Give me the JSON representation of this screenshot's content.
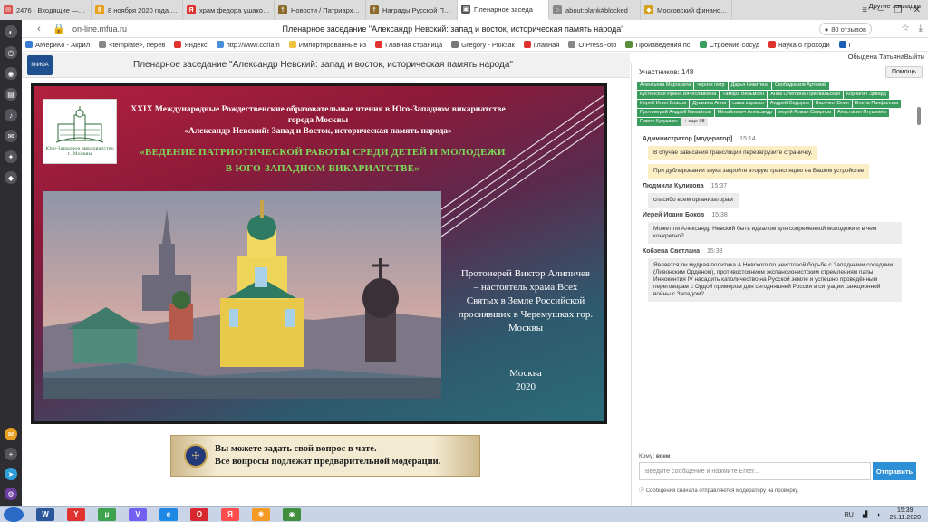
{
  "browser": {
    "tabs": [
      {
        "title": "2476 · Входящие — Яндекс",
        "color": "#d9534f",
        "glyph": "✉"
      },
      {
        "title": "8 ноября 2020 года. + Пр",
        "color": "#e8a020",
        "glyph": "8"
      },
      {
        "title": "храм федора ушакова в",
        "color": "#e0322e",
        "glyph": "Я"
      },
      {
        "title": "Новости / Патриархия.ru",
        "color": "#8a6a2a",
        "glyph": "†"
      },
      {
        "title": "Награды Русской Правос",
        "color": "#8a6a2a",
        "glyph": "†"
      },
      {
        "title": "Пленарное заседа",
        "color": "#555555",
        "glyph": "▣"
      },
      {
        "title": "about:blank#blocked",
        "color": "#888888",
        "glyph": "○"
      },
      {
        "title": "Московский финансово",
        "color": "#d4a017",
        "glyph": "◆"
      }
    ],
    "active_tab": 5,
    "url": "on-line.mfua.ru",
    "page_title": "Пленарное заседание \"Александр Невский: запад и восток, историческая память народа\"",
    "reviews_label": "80 отзывов",
    "bookmarks": [
      {
        "label": "АМериКо - Акрил",
        "color": "#3a7bd5"
      },
      {
        "label": "<template>, перев",
        "color": "#888888"
      },
      {
        "label": "Яндекс",
        "color": "#e0322e"
      },
      {
        "label": "http://www.coriam",
        "color": "#4a90d9"
      },
      {
        "label": "Импортированные из",
        "color": "#f0c040"
      },
      {
        "label": "Главная страница",
        "color": "#e0322e"
      },
      {
        "label": "Gregory - Рюкзак",
        "color": "#777777"
      },
      {
        "label": "Главная",
        "color": "#e0322e"
      },
      {
        "label": "О PressFoto",
        "color": "#888888"
      },
      {
        "label": "Произведения пс",
        "color": "#5a8f3a"
      },
      {
        "label": "Строение сосуд",
        "color": "#3a9d5d"
      },
      {
        "label": "наука о проходи",
        "color": "#e0322e"
      },
      {
        "label": "Г",
        "color": "#1a5fb4"
      }
    ],
    "bookmarks_other": "Другие закладки"
  },
  "header": {
    "event_title": "Пленарное заседание \"Александр Невский: запад и восток, историческая память народа\"",
    "user_name": "Обыдена Татьяна",
    "logout_label": "Выйти"
  },
  "slide": {
    "heading_line1": "XXIX Международные Рождественские образовательные чтения в Юго-Западном викариатстве города Москвы",
    "heading_line2": "«Александр Невский: Запад и Восток, историческая память народа»",
    "subtitle_line1": "«ВЕДЕНИЕ ПАТРИОТИЧЕСКОЙ РАБОТЫ СРЕДИ ДЕТЕЙ И МОЛОДЕЖИ",
    "subtitle_line2": "В ЮГО-ЗАПАДНОМ ВИКАРИАТСТВЕ»",
    "speaker": "Протоиерей Виктор Алипичев – настоятель храма Всех Святых в Земле Российской просиявших в Черемушках гор. Москвы",
    "city": "Москва",
    "year": "2020",
    "logo_caption": "Юго-Западное викариатство г. Москвы"
  },
  "banner": {
    "line1": "Вы можете задать свой вопрос в чате.",
    "line2": "Все вопросы подлежат предварительной модерации."
  },
  "chat": {
    "participants_label": "Участников: 148",
    "help_label": "Помощь",
    "participants": [
      "Алентьева Маргарита",
      "черняк петр",
      "Дарья Никитина",
      "Свободников Артемий",
      "Кустинская Ирина Вячеславовна",
      "Тамара Вельмсен",
      "Анна Олеговна Приевальская",
      "Корчагин Эдвард",
      "Иерей Илия Власов",
      "Душкина Анна",
      "саша караско",
      "Андрей Сидоров",
      "Васечко Юлия",
      "Елена Панфилова",
      "Протоиерей Андрей Михайлов",
      "Михайлевич Александр",
      "иерей Роман Смирнов",
      "Анастасия Птушкина",
      "Павел Кукушкин"
    ],
    "more_label": "+ еще 98",
    "messages": [
      {
        "author": "Администратор [модератор]",
        "time": "15:14",
        "texts": [
          "В случае зависания трансляции перезагрузите страничку.",
          "При дублировании звука закройте вторую трансляцию на Вашем устройстве"
        ],
        "note": true
      },
      {
        "author": "Людмила Куликова",
        "time": "15:37",
        "texts": [
          "спасибо всем организаторам"
        ],
        "note": false
      },
      {
        "author": "Иерей Иоанн Боков",
        "time": "15:38",
        "texts": [
          "Может ли Александр Невский быть идеалом для современной молодежи и в чем конкретно?"
        ],
        "note": false
      },
      {
        "author": "Кобзева Светлана",
        "time": "15:38",
        "texts": [
          "Является ли мудрая политика А.Невского по неистовой борьбе с Западными соседями (Ливонским Орденом), противостоянием экспансионистским стремлениям папы Иннокентия IV насадить католичество на Русской земле и успешно проведённым переговорам с Ордой примером для сегодняшней России в ситуации санкционной войны с Западом?"
        ],
        "note": false
      }
    ],
    "to_prefix": "Кому:",
    "to_value": "всем",
    "input_placeholder": "Введите сообщение и нажмите Enter...",
    "send_label": "Отправить",
    "hint": "Сообщения сначала отправляются модератору на проверку."
  },
  "taskbar": {
    "apps": [
      {
        "name": "word",
        "color": "#2b579a",
        "glyph": "W"
      },
      {
        "name": "yandex",
        "color": "#e0322e",
        "glyph": "Y"
      },
      {
        "name": "torrent",
        "color": "#3fa34d",
        "glyph": "μ"
      },
      {
        "name": "viber",
        "color": "#7360f2",
        "glyph": "V"
      },
      {
        "name": "ie",
        "color": "#1e88e5",
        "glyph": "e"
      },
      {
        "name": "opera",
        "color": "#d7282f",
        "glyph": "O"
      },
      {
        "name": "yandex-2",
        "color": "#ff4d4d",
        "glyph": "Я"
      },
      {
        "name": "odnoklassniki",
        "color": "#f59a23",
        "glyph": "✱"
      },
      {
        "name": "chrome",
        "color": "#3f8f3f",
        "glyph": "◉"
      }
    ],
    "lang": "RU",
    "time": "15:39",
    "date": "25.11.2020"
  }
}
